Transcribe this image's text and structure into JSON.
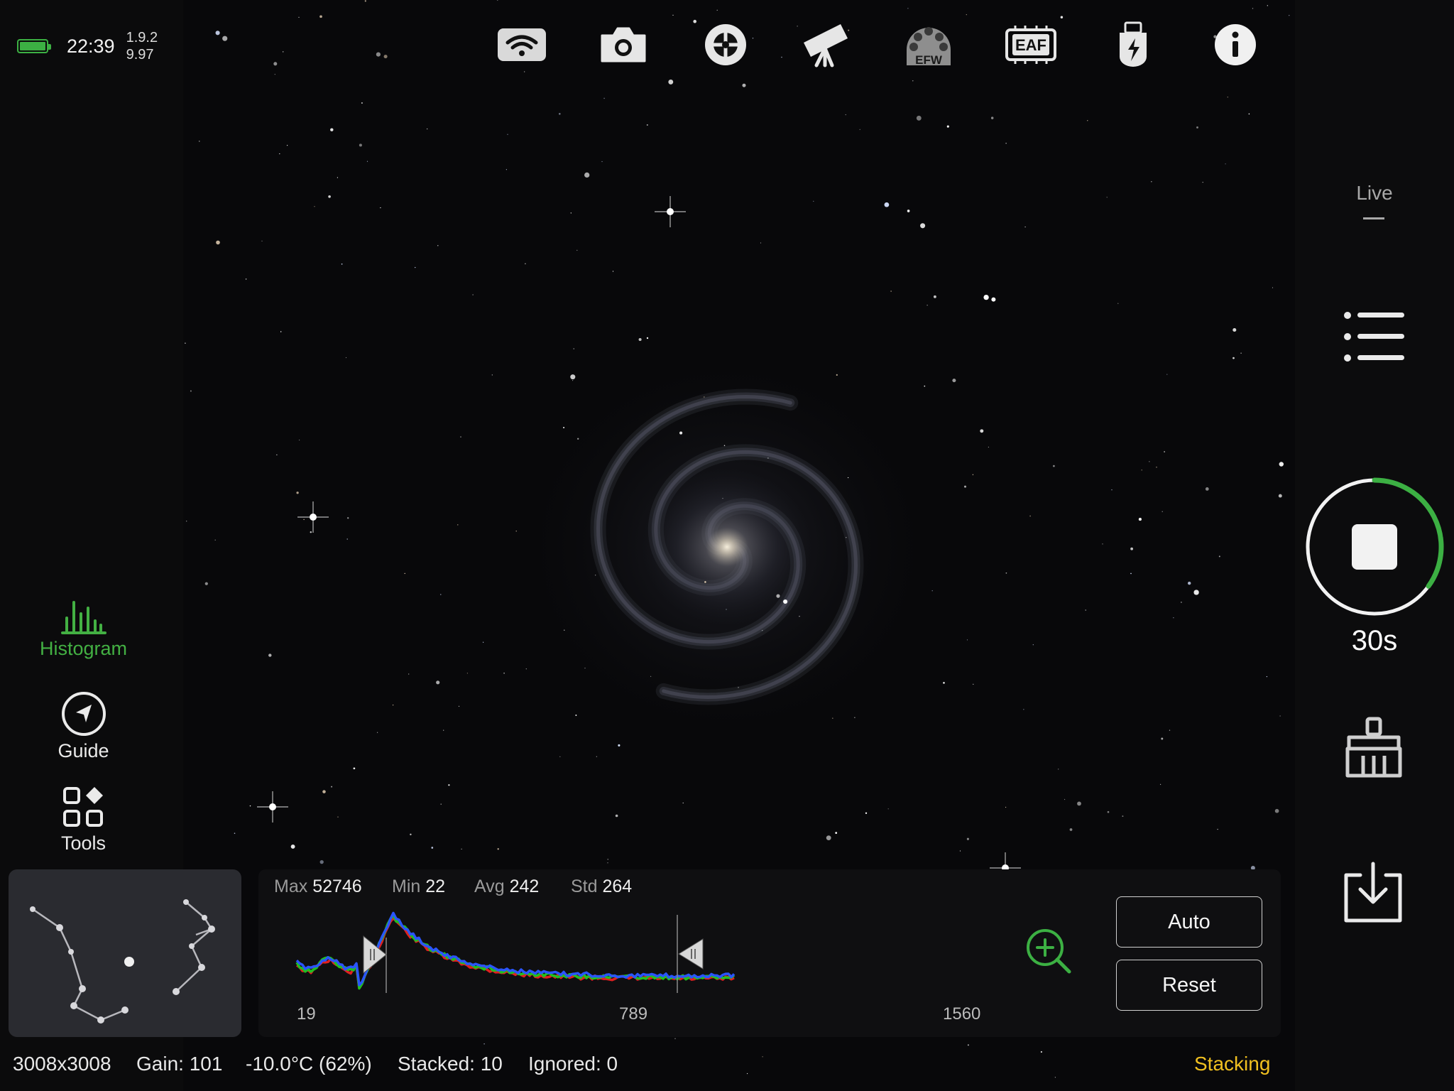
{
  "status": {
    "time": "22:39",
    "version_top": "1.9.2",
    "version_bottom": "9.97",
    "battery_color": "#3cb043"
  },
  "toolbar": {
    "icons": [
      "wifi-icon",
      "camera-icon",
      "target-icon",
      "telescope-icon",
      "efw-icon",
      "eaf-icon",
      "usb-power-icon",
      "info-icon"
    ],
    "efw_label": "EFW",
    "eaf_label": "EAF"
  },
  "left_tools": {
    "histogram": "Histogram",
    "guide": "Guide",
    "tools": "Tools",
    "active_color": "#43b043"
  },
  "histogram": {
    "max_label": "Max",
    "max_value": "52746",
    "min_label": "Min",
    "min_value": "22",
    "avg_label": "Avg",
    "avg_value": "242",
    "std_label": "Std",
    "std_value": "264",
    "axis_left": "19",
    "axis_mid": "789",
    "axis_right": "1560",
    "auto_button": "Auto",
    "reset_button": "Reset"
  },
  "right_panel": {
    "mode": "Live",
    "exposure": "30s",
    "progress_fraction": 0.35,
    "accent": "#3cb043"
  },
  "status_bar": {
    "resolution": "3008x3008",
    "gain": "Gain: 101",
    "temperature": "-10.0°C (62%)",
    "stacked": "Stacked: 10",
    "ignored": "Ignored: 0",
    "state": "Stacking",
    "state_color": "#f0c020"
  }
}
